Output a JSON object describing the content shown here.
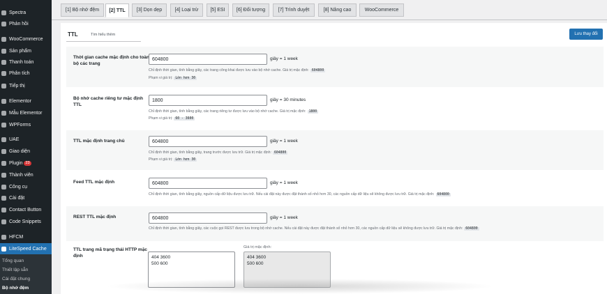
{
  "sidebar": {
    "items": [
      {
        "label": "Spectra",
        "icon": "spectra-icon"
      },
      {
        "label": "Phản hồi",
        "icon": "feedback-icon"
      },
      {
        "label": "WooCommerce",
        "icon": "woocommerce-icon"
      },
      {
        "label": "Sản phẩm",
        "icon": "products-icon"
      },
      {
        "label": "Thanh toán",
        "icon": "payments-icon"
      },
      {
        "label": "Phân tích",
        "icon": "analytics-icon"
      },
      {
        "label": "Tiếp thị",
        "icon": "marketing-icon"
      },
      {
        "label": "Elementor",
        "icon": "elementor-icon"
      },
      {
        "label": "Mẫu Elementor",
        "icon": "templates-icon"
      },
      {
        "label": "WPForms",
        "icon": "wpforms-icon"
      },
      {
        "label": "UAE",
        "icon": "uae-icon"
      },
      {
        "label": "Giao diện",
        "icon": "appearance-icon"
      },
      {
        "label": "Plugin",
        "icon": "plugin-icon",
        "badge": "23"
      },
      {
        "label": "Thành viên",
        "icon": "users-icon"
      },
      {
        "label": "Công cụ",
        "icon": "tools-icon"
      },
      {
        "label": "Cài đặt",
        "icon": "settings-icon"
      },
      {
        "label": "Contact Button",
        "icon": "contact-button-icon"
      },
      {
        "label": "Code Snippets",
        "icon": "code-snippets-icon"
      },
      {
        "label": "HFCM",
        "icon": "hfcm-icon"
      },
      {
        "label": "LiteSpeed Cache",
        "icon": "litespeed-icon",
        "active": true
      }
    ],
    "submenu": [
      "Tổng quan",
      "Thiết lập sẵn",
      "Cài đặt chung",
      "Bộ nhớ đệm"
    ],
    "submenu_current": "Bộ nhớ đệm"
  },
  "tabs": [
    "[1] Bộ nhớ đệm",
    "[2] TTL",
    "[3] Dọn dẹp",
    "[4] Loại trừ",
    "[5] ESI",
    "[6] Đối tượng",
    "[7] Trình duyệt",
    "[8] Nâng cao",
    "WooCommerce"
  ],
  "active_tab": "[2] TTL",
  "section": {
    "title": "TTL",
    "learn_more": "Tìm hiểu thêm",
    "save_label": "Lưu thay đổi"
  },
  "settings": [
    {
      "label": "Thời gian cache mặc định cho toàn bộ các trang",
      "value": "604800",
      "unit": "giây = 1 week",
      "desc": "Chỉ định thời gian, tính bằng giây, các trang công khai được lưu vào bộ nhớ cache. Giá trị mặc định:",
      "default_value": "604800",
      "range_label": "Phạm vi giá trị:",
      "range": "Lớn hơn 30"
    },
    {
      "label": "Bộ nhớ cache riêng tư mặc định TTL",
      "value": "1800",
      "unit": "giây = 30 minutes",
      "desc": "Chỉ định thời gian, tính bằng giây, các trang riêng tư được lưu vào bộ nhớ cache. Giá trị mặc định:",
      "default_value": "1800",
      "range_label": "Phạm vi giá trị:",
      "range": "60 - 3600"
    },
    {
      "label": "TTL mặc định trang chủ",
      "value": "604800",
      "unit": "giây = 1 week",
      "desc": "Chỉ định thời gian, tính bằng giây, trang trước được lưu trữ. Giá trị mặc định:",
      "default_value": "604800",
      "range_label": "Phạm vi giá trị:",
      "range": "Lớn hơn 30"
    },
    {
      "label": "Feed TTL mặc định",
      "value": "604800",
      "unit": "giây = 1 week",
      "desc": "Chỉ định thời gian, tính bằng giây, nguồn cấp dữ liệu được lưu trữ. Nếu cài đặt này được đặt thành số nhỏ hơn 30, các nguồn cấp dữ liệu sẽ không được lưu trữ. Giá trị mặc định:",
      "default_value": "604800"
    },
    {
      "label": "REST TTL mặc định",
      "value": "604800",
      "unit": "giây = 1 week",
      "desc": "Chỉ định thời gian, tính bằng giây, các cuộc gọi REST được lưu trong bộ nhớ cache. Nếu cài đặt này được đặt thành số nhỏ hơn 30, các nguồn cấp dữ liệu sẽ không được lưu trữ. Giá trị mặc định:",
      "default_value": "604800"
    }
  ],
  "http_status": {
    "label": "TTL trang mã trạng thái HTTP mặc định",
    "value": "404 3600\n500 600",
    "default_label": "Giá trị mặc định:",
    "default_value": "404 3600\n500 600"
  },
  "colors": {
    "sidebar_bg": "#1d2327",
    "accent": "#2271b1",
    "badge": "#d63638"
  }
}
